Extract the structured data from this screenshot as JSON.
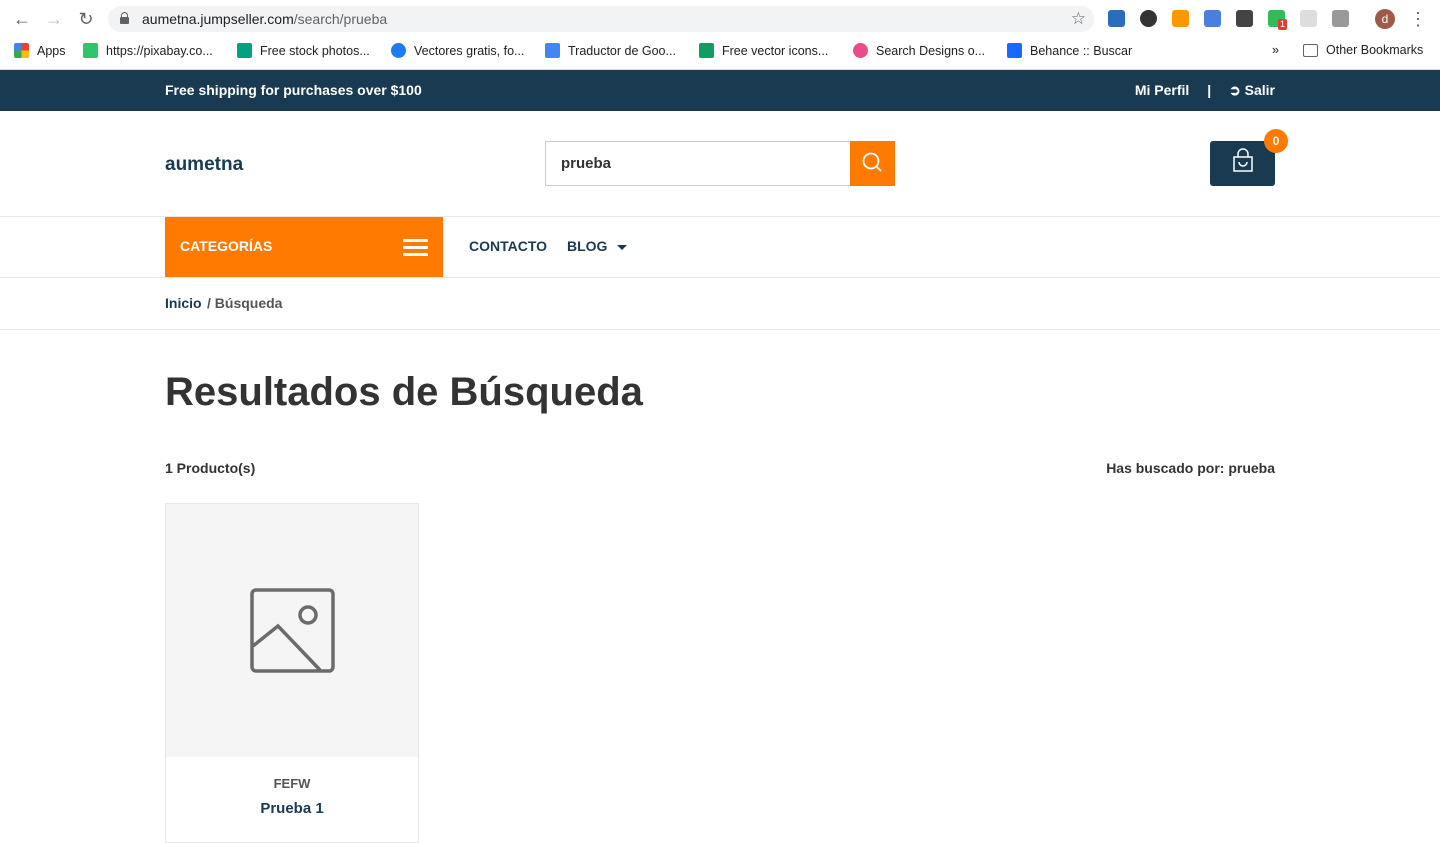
{
  "browser": {
    "url_host": "aumetna.jumpseller.com",
    "url_path": "/search/prueba",
    "avatar_letter": "d",
    "ext_badge": "1",
    "bookmarks": [
      {
        "label": "Apps",
        "color": "#e94335"
      },
      {
        "label": "https://pixabay.co...",
        "color": "#2ec66d"
      },
      {
        "label": "Free stock photos...",
        "color": "#05a081"
      },
      {
        "label": "Vectores gratis, fo...",
        "color": "#1e7bf2"
      },
      {
        "label": "Traductor de Goo...",
        "color": "#4285f4"
      },
      {
        "label": "Free vector icons...",
        "color": "#0e9e5f"
      },
      {
        "label": "Search Designs o...",
        "color": "#ea4c89"
      },
      {
        "label": "Behance :: Buscar",
        "color": "#1769ff"
      }
    ],
    "more": "»",
    "other_bookmarks": "Other Bookmarks"
  },
  "topbar": {
    "shipping": "Free shipping for purchases over $100",
    "profile": "Mi Perfil",
    "separator": "|",
    "logout": "Salir"
  },
  "header": {
    "logo": "aumetna",
    "search_value": "prueba",
    "cart_count": "0"
  },
  "nav": {
    "categories": "CATEGORÍAS",
    "contact": "CONTACTO",
    "blog": "BLOG"
  },
  "breadcrumb": {
    "home": "Inicio",
    "current": "/ Búsqueda"
  },
  "main": {
    "title": "Resultados de Búsqueda",
    "count": "1 Producto(s)",
    "searched": "Has buscado por: prueba"
  },
  "product": {
    "brand": "FEFW",
    "name": "Prueba 1"
  },
  "colors": {
    "primary": "#1a3a52",
    "accent": "#ff7a00"
  }
}
